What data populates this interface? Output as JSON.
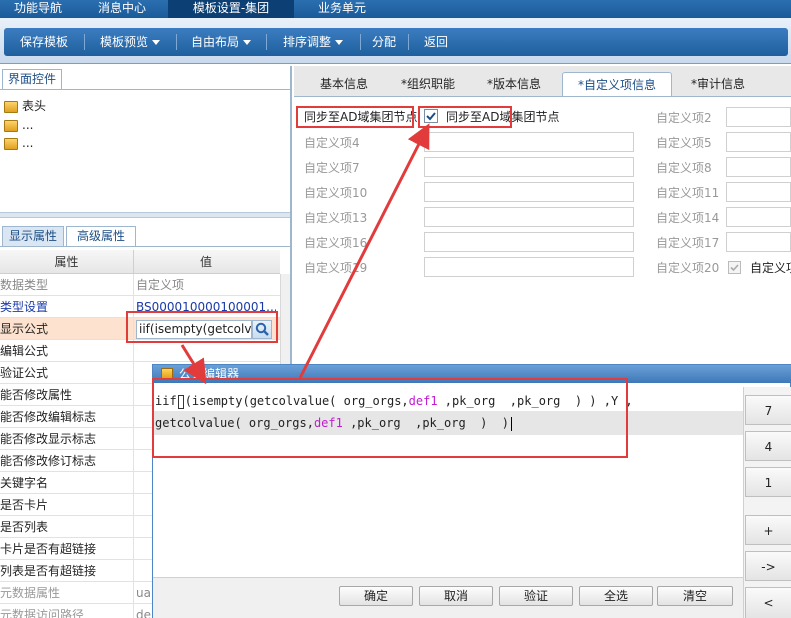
{
  "nav": {
    "tabs": [
      {
        "label": "功能导航"
      },
      {
        "label": "消息中心"
      },
      {
        "label": "模板设置-集团"
      },
      {
        "label": "业务单元"
      }
    ]
  },
  "toolbar": {
    "save": "保存模板",
    "preview": "模板预览",
    "layout": "自由布局",
    "sort": "排序调整",
    "assign": "分配",
    "back": "返回"
  },
  "left": {
    "controls_tab": "界面控件",
    "tree": [
      "表头",
      "...",
      "..."
    ],
    "tabs": {
      "display": "显示属性",
      "advanced": "高级属性"
    },
    "headers": {
      "attr": "属性",
      "value": "值"
    },
    "rows": [
      {
        "name": "数据类型",
        "value": "自定义项"
      },
      {
        "name": "类型设置",
        "value": "BS000010000100001..."
      },
      {
        "name": "显示公式",
        "value": "iif(isempty(getcolvalu"
      },
      {
        "name": "编辑公式",
        "value": ""
      },
      {
        "name": "验证公式",
        "value": ""
      },
      {
        "name": "能否修改属性",
        "value": ""
      },
      {
        "name": "能否修改编辑标志",
        "value": ""
      },
      {
        "name": "能否修改显示标志",
        "value": ""
      },
      {
        "name": "能否修改修订标志",
        "value": ""
      },
      {
        "name": "关键字名",
        "value": ""
      },
      {
        "name": "是否卡片",
        "value": ""
      },
      {
        "name": "是否列表",
        "value": ""
      },
      {
        "name": "卡片是否有超链接",
        "value": ""
      },
      {
        "name": "列表是否有超链接",
        "value": ""
      },
      {
        "name": "元数据属性",
        "value": "ua"
      },
      {
        "name": "元数据访问路径",
        "value": "de"
      }
    ]
  },
  "right": {
    "tabs": [
      "基本信息",
      "*组织职能",
      "*版本信息",
      "*自定义项信息",
      "*审计信息"
    ],
    "sync_label": "同步至AD域集团节点",
    "sync_checkbox_label": "同步至AD域集团节点",
    "fields_col1": [
      "自定义项4",
      "自定义项7",
      "自定义项10",
      "自定义项13",
      "自定义项16",
      "自定义项19"
    ],
    "fields_col2": [
      "自定义项2",
      "自定义项5",
      "自定义项8",
      "自定义项11",
      "自定义项14",
      "自定义项17",
      "自定义项20"
    ],
    "last_checkbox_label": "自定义项"
  },
  "editor": {
    "title": "公式编辑器",
    "line1": {
      "a": "iif",
      "b": "(isempty(getcolvalue( org_orgs,",
      "c": "def1",
      "d": " ,pk_org  ,pk_org  ) ) ,Y ,"
    },
    "line2": {
      "a": "getcolvalue( org_orgs,",
      "b": "def1",
      "c": " ,pk_org  ,pk_org  )  )"
    },
    "buttons": {
      "ok": "确定",
      "cancel": "取消",
      "validate": "验证",
      "select_all": "全选",
      "clear": "清空"
    },
    "keypad": [
      "7",
      "4",
      "1",
      "+",
      "->",
      "<"
    ]
  }
}
